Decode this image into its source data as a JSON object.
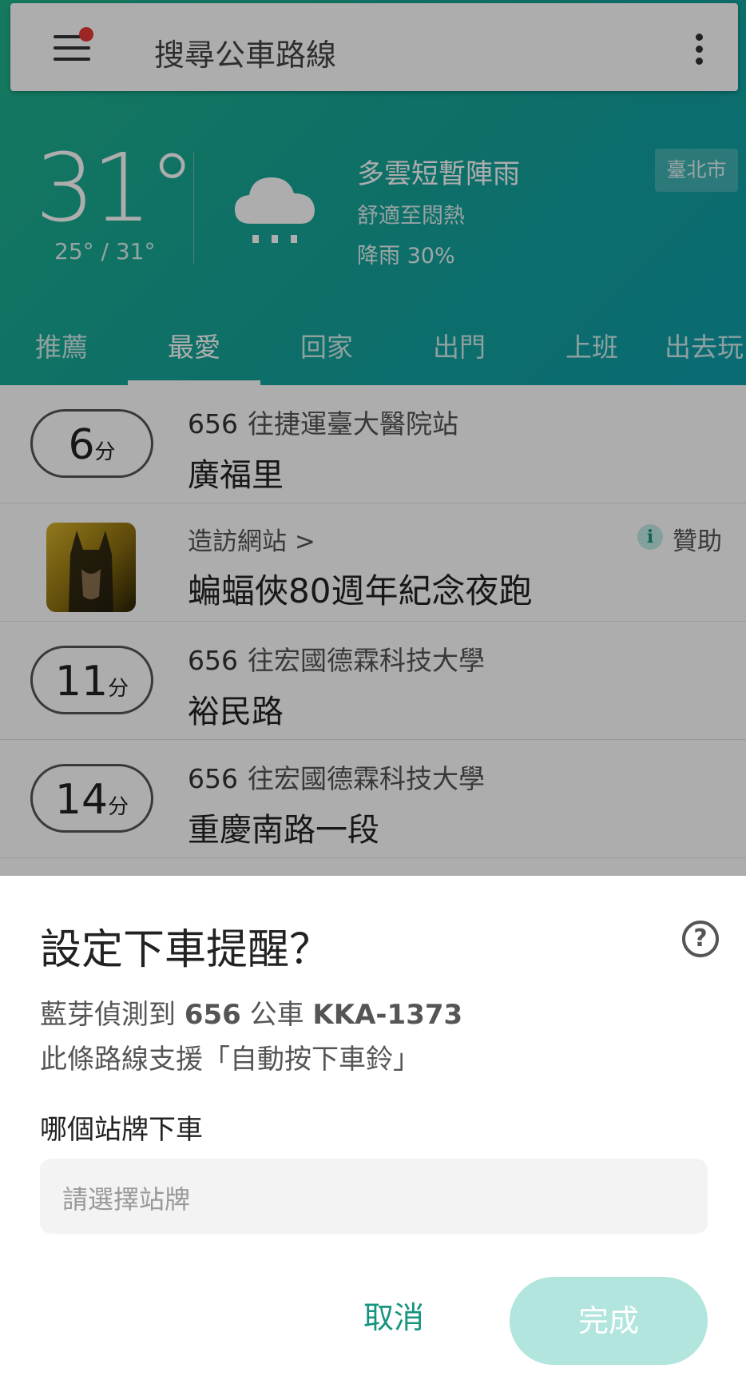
{
  "search": {
    "placeholder": "搜尋公車路線"
  },
  "weather": {
    "temperature": "31°",
    "range": "25° / 31°",
    "description": "多雲短暫陣雨",
    "comfort": "舒適至悶熱",
    "rain_chance": "降雨 30%",
    "city": "臺北市",
    "icon": "rain-cloud-icon"
  },
  "tabs": [
    {
      "label": "推薦",
      "active": false
    },
    {
      "label": "最愛",
      "active": true
    },
    {
      "label": "回家",
      "active": false
    },
    {
      "label": "出門",
      "active": false
    },
    {
      "label": "上班",
      "active": false
    },
    {
      "label": "出去玩",
      "active": false
    }
  ],
  "list": {
    "rows": [
      {
        "eta_num": "6",
        "eta_unit": "分",
        "route": "656",
        "direction": "往捷運臺大醫院站",
        "stop": "廣福里"
      },
      {
        "eta_num": "11",
        "eta_unit": "分",
        "route": "656",
        "direction": "往宏國德霖科技大學",
        "stop": "裕民路"
      },
      {
        "eta_num": "14",
        "eta_unit": "分",
        "route": "656",
        "direction": "往宏國德霖科技大學",
        "stop": "重慶南路一段"
      }
    ],
    "ad": {
      "visit_label": "造訪網站 >",
      "title": "蝙蝠俠80週年紀念夜跑",
      "sponsor_label": "贊助"
    }
  },
  "sheet": {
    "title": "設定下車提醒？",
    "detect_prefix": "藍芽偵測到 ",
    "bus_route": "656",
    "detect_mid": " 公車 ",
    "plate": "KKA-1373",
    "support_text": "此條路線支援「自動按下車鈴」",
    "which_stop_label": "哪個站牌下車",
    "stop_placeholder": "請選擇站牌",
    "cancel_label": "取消",
    "done_label": "完成"
  },
  "colors": {
    "accent": "#17957f",
    "done_disabled": "#b1e5dd",
    "hero_start": "#1fb38a",
    "hero_end": "#0f9eaa"
  }
}
